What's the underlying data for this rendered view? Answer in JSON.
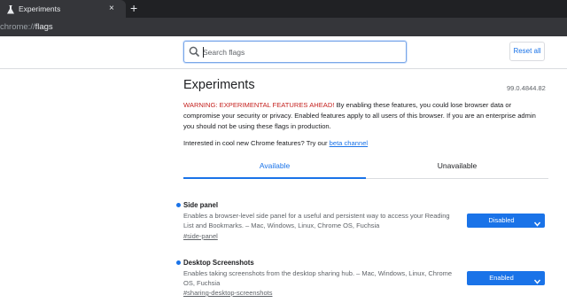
{
  "browser": {
    "tab_title": "Experiments",
    "tab_close_glyph": "×",
    "newtab_glyph": "+",
    "url_prefix": "chrome://",
    "url_path": "flags",
    "theme": {
      "tabstrip": "#202124",
      "toolbar": "#35363a"
    }
  },
  "toolbar": {
    "search_placeholder": "Search flags",
    "reset_label": "Reset all"
  },
  "header": {
    "title": "Experiments",
    "version": "99.0.4844.82"
  },
  "warning": {
    "prefix": "WARNING: EXPERIMENTAL FEATURES AHEAD!",
    "body": " By enabling these features, you could lose browser data or compromise your security or privacy. Enabled features apply to all users of this browser. If you are an enterprise admin you should not be using these flags in production."
  },
  "interest": {
    "text": "Interested in cool new Chrome features? Try our ",
    "link": "beta channel"
  },
  "tabs": [
    {
      "label": "Available",
      "selected": true
    },
    {
      "label": "Unavailable",
      "selected": false
    }
  ],
  "flags": [
    {
      "name": "Side panel",
      "description": "Enables a browser-level side panel for a useful and persistent way to access your Reading List and Bookmarks. – Mac, Windows, Linux, Chrome OS, Fuchsia",
      "anchor": "#side-panel",
      "state": "Disabled"
    },
    {
      "name": "Desktop Screenshots",
      "description": "Enables taking screenshots from the desktop sharing hub. – Mac, Windows, Linux, Chrome OS, Fuchsia",
      "anchor": "#sharing-desktop-screenshots",
      "state": "Enabled"
    }
  ],
  "icons": {
    "favicon": "flask-icon",
    "search": "search-icon",
    "chevron": "chevron-down-icon"
  },
  "colors": {
    "accent": "#1a73e8",
    "warning": "#c5221f"
  }
}
